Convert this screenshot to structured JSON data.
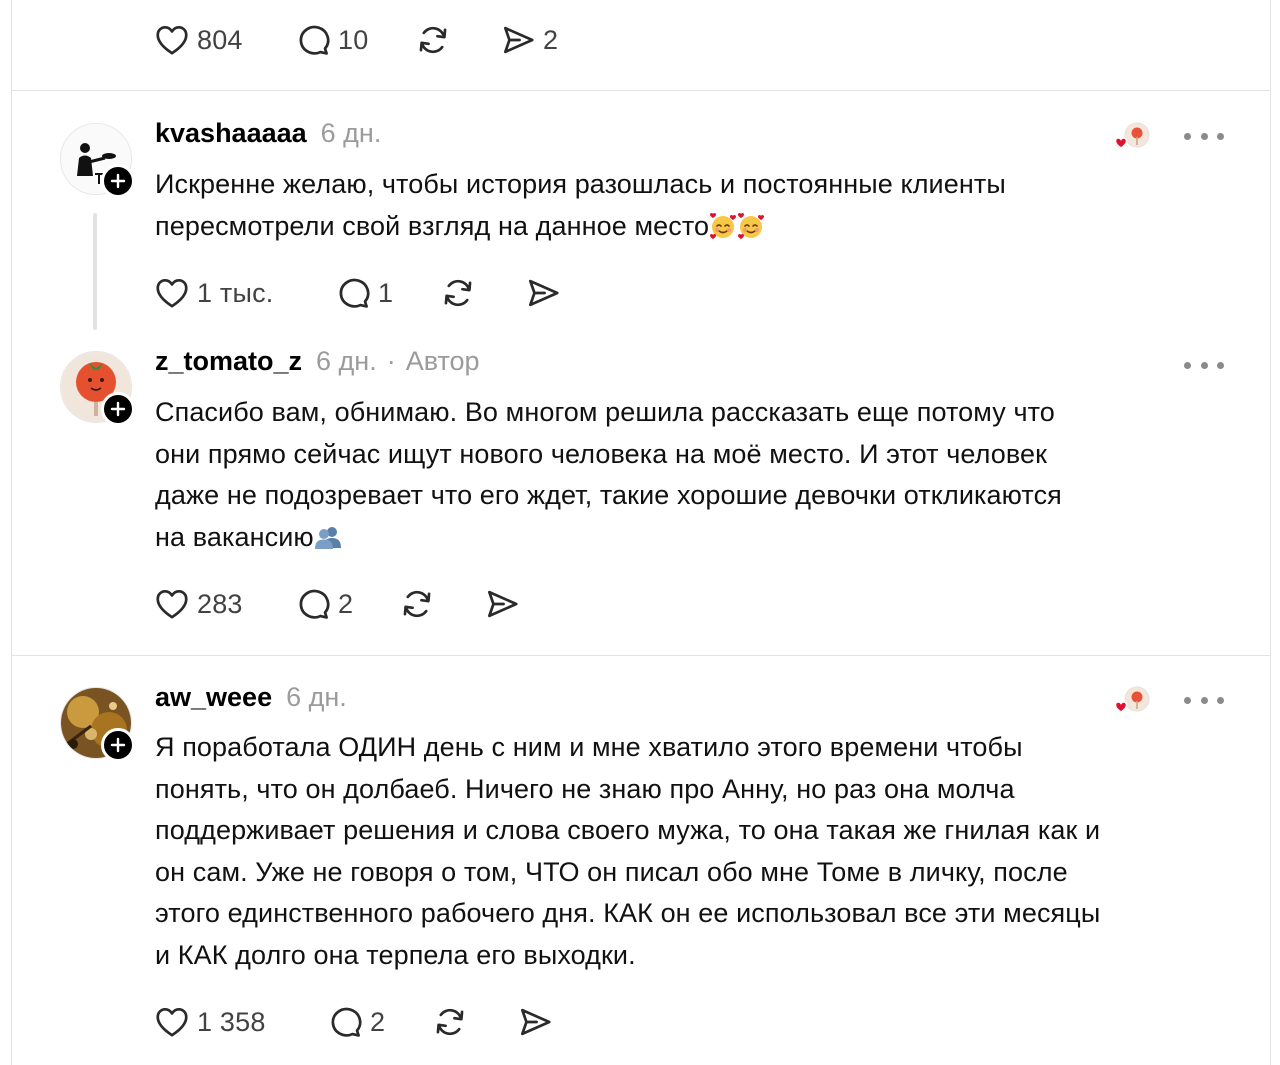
{
  "top_post": {
    "likes": "804",
    "replies": "10",
    "shares": "2"
  },
  "comments": [
    {
      "username": "kvashaaaaa",
      "time": "6 дн.",
      "lines": [
        "Искренне желаю, чтобы история разошлась и постоянные клиенты",
        "пересмотрели свой взгляд на данное место"
      ],
      "emoji": "smiling-face-with-hearts",
      "likes": "1 тыс.",
      "replies": "1",
      "liked_by_author": true
    },
    {
      "username": "z_tomato_z",
      "time": "6 дн.",
      "separator": "·",
      "author_badge": "Автор",
      "lines": [
        "Спасибо вам, обнимаю. Во многом решила рассказать еще потому что",
        "они прямо сейчас ищут нового человека на моё место. И этот человек",
        "даже не подозревает что его ждет, такие хорошие девочки откликаются",
        "на вакансию"
      ],
      "emoji": "busts-in-silhouette",
      "likes": "283",
      "replies": "2",
      "liked_by_author": false
    },
    {
      "username": "aw_weee",
      "time": "6 дн.",
      "lines": [
        "Я поработала ОДИН день с ним и мне хватило этого времени чтобы",
        "понять, что он долбаеб. Ничего не знаю про Анну, но раз она молча",
        "поддерживает решения и слова своего мужа, то она такая же гнилая как и",
        "он сам. Уже не говоря о том, ЧТО он писал обо мне Томе в личку, после",
        "этого единственного рабочего дня. КАК он ее использовал все эти месяцы",
        "и КАК долго она терпела его выходки."
      ],
      "likes": "1 358",
      "replies": "2",
      "liked_by_author": true
    }
  ],
  "icons": {
    "like": "heart-icon",
    "reply": "comment-bubble-icon",
    "repost": "repost-icon",
    "share": "send-icon",
    "more": "more-dots-icon",
    "follow": "plus-icon",
    "liked_by_author": "author-liked-heart-icon"
  },
  "colors": {
    "text": "#111111",
    "muted": "#9b9b9b",
    "icon": "#424242",
    "divider": "#e3e3e3",
    "heart_red": "#e0102e"
  }
}
